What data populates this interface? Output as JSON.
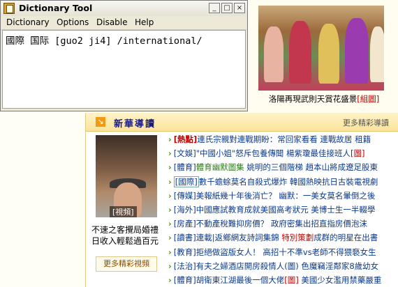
{
  "window": {
    "title": "Dictionary Tool",
    "controls": {
      "minimize": "_",
      "maximize": "□",
      "close": "×"
    },
    "menu": [
      "Dictionary",
      "Options",
      "Disable",
      "Help"
    ],
    "content": "國際 国际 [guo2 ji4] /international/"
  },
  "background_page": {
    "photo_caption": "洛陽再現武則天賞花盛景",
    "photo_caption_link": "[組圖]",
    "section": {
      "title": "新華導讀",
      "more_link": "更多精彩導讀",
      "video_label": "[視頻]",
      "video_caption": "不速之客攪局婚禮 日收入輕鬆過百元",
      "video_more": "更多精彩視頻",
      "news": [
        {
          "tag": "[熱點]",
          "tag_style": "red",
          "text": "連氏宗親對連戰期盼：常回家看看 連戰故居 租籍"
        },
        {
          "tag": "[文娛]",
          "tag_style": "",
          "text": "\"中國小姐\"怒斥包養傳聞 楊紫瓊最佳接班人",
          "suffix": "[圖]"
        },
        {
          "tag": "[體育]",
          "tag_style": "",
          "text_green": "體育幽默圖集",
          "text": " 姚明的三個階梯 趙本山將成遼足股東"
        },
        {
          "tag": "[國際]",
          "tag_style": "boxed",
          "text": "數千蟾蜍莫名自殺式爆炸 韓國熱映抗日古裝電視劇"
        },
        {
          "tag": "[傳媒]",
          "tag_style": "",
          "text": "美報紙幾十年後消亡？ 幽默：一美女莫名暈倒之後"
        },
        {
          "tag": "[海外]",
          "tag_style": "",
          "text": "中國應試教育成就美國高考狀元 美博士生一半輟學"
        },
        {
          "tag": "[房產]",
          "tag_style": "",
          "text": "不動產稅難抑房價？ 政府密集出招直指房價泡沫"
        },
        {
          "tag": "[讀書]",
          "tag_style": "",
          "text": "連載|返鄉網友詩詞集錦 ",
          "text_red": "特別策劃",
          "text_after": "成群的明星在出書"
        },
        {
          "tag": "[教育]",
          "tag_style": "",
          "text": "拒絕做盜版女人！ 高招十不準vs老師不得猥褻女生"
        },
        {
          "tag": "[法治]",
          "tag_style": "",
          "text": "有夫之婦酒店開房殺情人(圖) 色魔竊淫鄰家8歲幼女"
        },
        {
          "tag": "[體育]",
          "tag_style": "",
          "text": "胡衛東江湖最後一個大佬",
          "suffix": "[圖]",
          "text_after": " 美國少女濫用禁藥嚴重"
        }
      ]
    }
  },
  "colors": {
    "window_bg": "#ece9d8",
    "title_gradient": "#f7f6f1",
    "link_blue": "#0b3a8c",
    "accent_red": "#c00000",
    "section_orange": "#f39a13"
  },
  "icons": [
    "app-icon",
    "minimize-icon",
    "maximize-icon",
    "close-icon",
    "arrow-icon"
  ]
}
